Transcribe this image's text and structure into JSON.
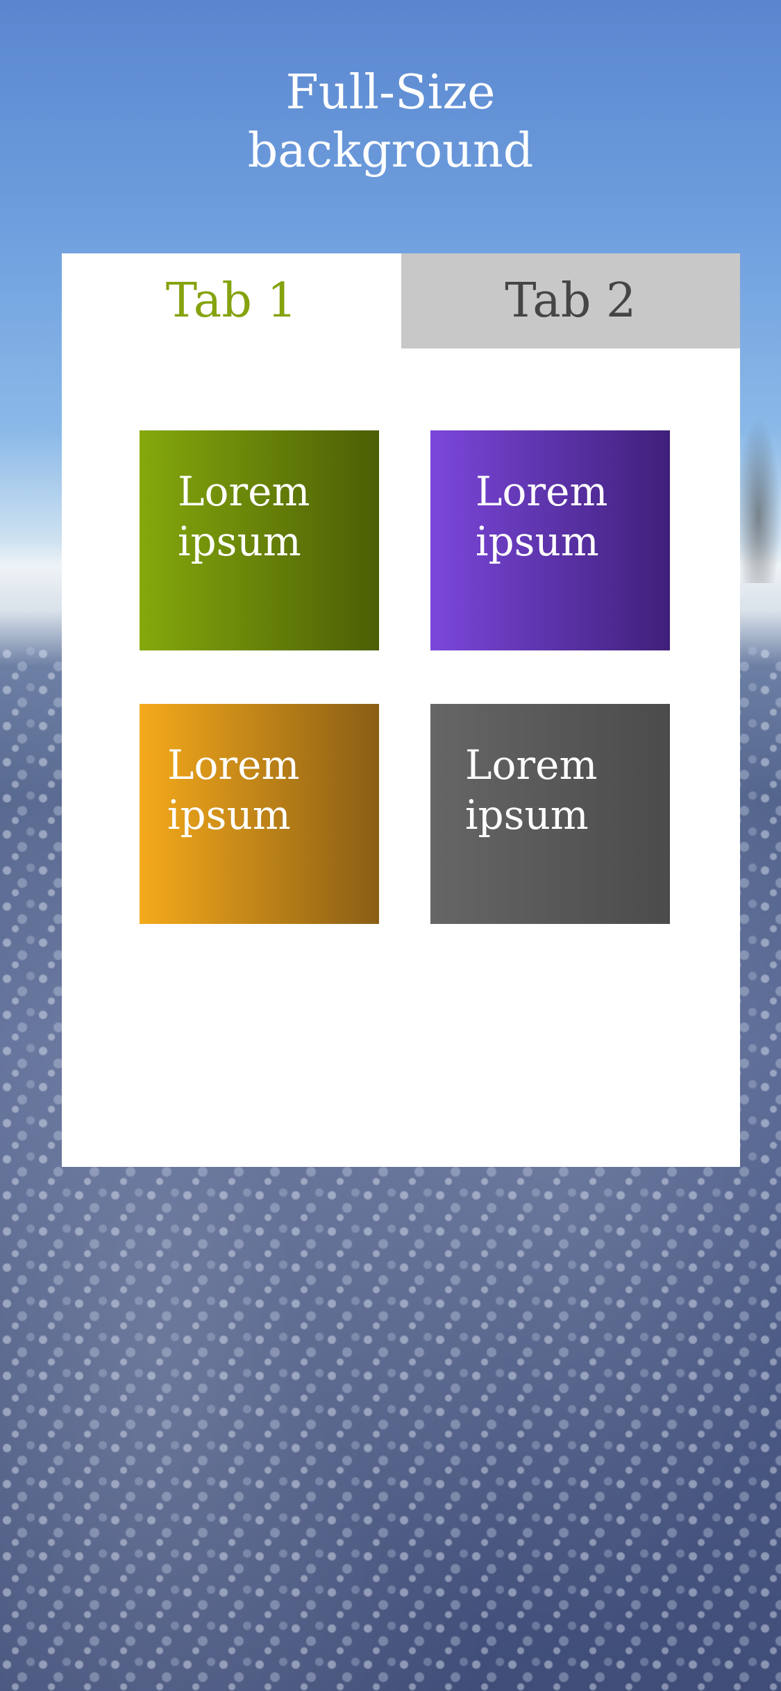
{
  "header": {
    "title_line1": "Full-Size",
    "title_line2": "background"
  },
  "tabs": [
    {
      "label": "Tab 1",
      "active": true
    },
    {
      "label": "Tab 2",
      "active": false
    }
  ],
  "tiles": [
    {
      "line1": "Lorem",
      "line2": "ipsum",
      "color_start": "#85a80c",
      "color_end": "#4b5e06"
    },
    {
      "line1": "Lorem",
      "line2": "ipsum",
      "color_start": "#7b47db",
      "color_end": "#3f207a"
    },
    {
      "line1": "Lorem",
      "line2": "ipsum",
      "color_start": "#f5aa1b",
      "color_end": "#8a5e15"
    },
    {
      "line1": "Lorem",
      "line2": "ipsum",
      "color_start": "#666666",
      "color_end": "#4b4b4b"
    }
  ],
  "colors": {
    "active_tab_text": "#85a30f",
    "inactive_tab_bg": "#c8c8c8",
    "inactive_tab_text": "#454545"
  }
}
